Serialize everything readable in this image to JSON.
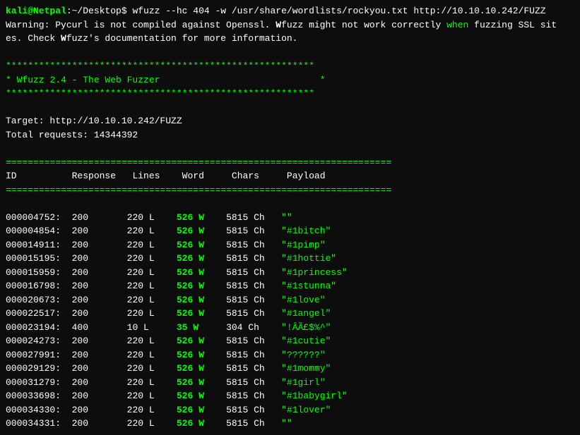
{
  "terminal": {
    "prompt": {
      "host": "kali@Netpal",
      "path": ":~/Desktop",
      "dollar": "$ ",
      "command": "wfuzz --hc 404 -w /usr/share/wordlists/rockyou.txt http://10.10.10.242/FUZZ"
    },
    "warning": {
      "line1": "Warning: Pycurl is not compiled against Openssl. Wfuzz might not work correctly when fuzzing SSL sit",
      "line2": "es. Check Wfuzz's documentation for more information."
    },
    "divider_stars": "********************************************************",
    "title_line": "* Wfuzz 2.4 - The Web Fuzzer                             *",
    "target_label": "Target: http://10.10.10.242/FUZZ",
    "total_requests": "Total requests: 14344392",
    "table_divider": "======================================================================",
    "col_headers": {
      "id": "ID",
      "response": "Response",
      "lines": "Lines",
      "word": "Word",
      "chars": "Chars",
      "payload": "Payload"
    },
    "rows": [
      {
        "id": "000004752:",
        "response": "200",
        "lines": "220 L",
        "word": "526 W",
        "chars": "5815 Ch",
        "payload": "\"\""
      },
      {
        "id": "000004854:",
        "response": "200",
        "lines": "220 L",
        "word": "526 W",
        "chars": "5815 Ch",
        "payload": "\"#1bitch\""
      },
      {
        "id": "000014911:",
        "response": "200",
        "lines": "220 L",
        "word": "526 W",
        "chars": "5815 Ch",
        "payload": "\"#1pimp\""
      },
      {
        "id": "000015195:",
        "response": "200",
        "lines": "220 L",
        "word": "526 W",
        "chars": "5815 Ch",
        "payload": "\"#1hottie\""
      },
      {
        "id": "000015959:",
        "response": "200",
        "lines": "220 L",
        "word": "526 W",
        "chars": "5815 Ch",
        "payload": "\"#1princess\""
      },
      {
        "id": "000016798:",
        "response": "200",
        "lines": "220 L",
        "word": "526 W",
        "chars": "5815 Ch",
        "payload": "\"#1stunna\""
      },
      {
        "id": "000020673:",
        "response": "200",
        "lines": "220 L",
        "word": "526 W",
        "chars": "5815 Ch",
        "payload": "\"#1love\""
      },
      {
        "id": "000022517:",
        "response": "200",
        "lines": "220 L",
        "word": "526 W",
        "chars": "5815 Ch",
        "payload": "\"#1angel\""
      },
      {
        "id": "000023194:",
        "response": "400",
        "lines": "10 L",
        "word": "35 W",
        "chars": "304 Ch",
        "payload": "\"!ÂÃ£$%^\""
      },
      {
        "id": "000024273:",
        "response": "200",
        "lines": "220 L",
        "word": "526 W",
        "chars": "5815 Ch",
        "payload": "\"#1cutie\""
      },
      {
        "id": "000027991:",
        "response": "200",
        "lines": "220 L",
        "word": "526 W",
        "chars": "5815 Ch",
        "payload": "\"??????\""
      },
      {
        "id": "000029129:",
        "response": "200",
        "lines": "220 L",
        "word": "526 W",
        "chars": "5815 Ch",
        "payload": "\"#1mommy\""
      },
      {
        "id": "000031279:",
        "response": "200",
        "lines": "220 L",
        "word": "526 W",
        "chars": "5815 Ch",
        "payload": "\"#1girl\""
      },
      {
        "id": "000033698:",
        "response": "200",
        "lines": "220 L",
        "word": "526 W",
        "chars": "5815 Ch",
        "payload": "\"#1babygirl\""
      },
      {
        "id": "000034330:",
        "response": "200",
        "lines": "220 L",
        "word": "526 W",
        "chars": "5815 Ch",
        "payload": "\"#1lover\""
      },
      {
        "id": "000034331:",
        "response": "200",
        "lines": "220 L",
        "word": "526 W",
        "chars": "5815 Ch",
        "payload": "\"\""
      }
    ]
  }
}
